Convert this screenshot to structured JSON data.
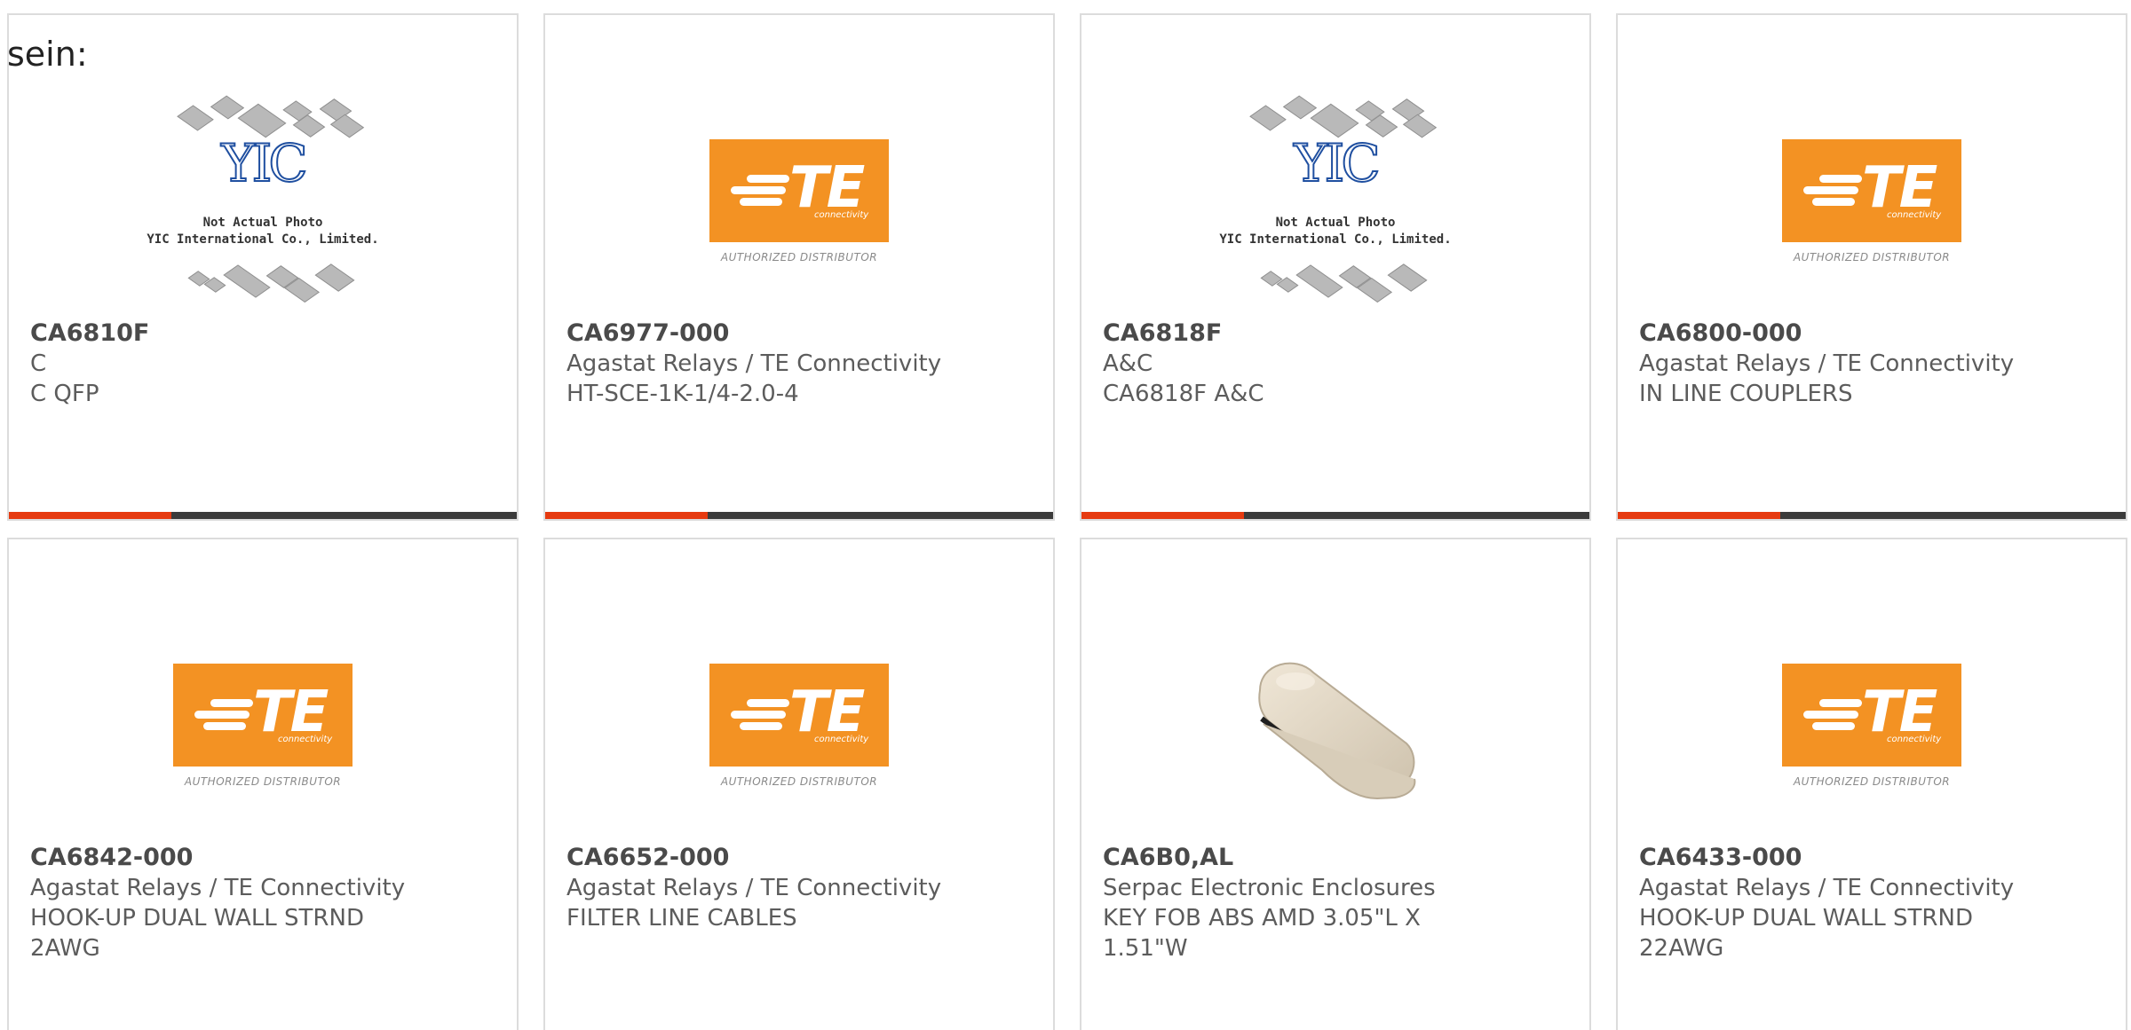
{
  "intro_text": "sein:",
  "products": [
    {
      "part": "CA6810F",
      "maker": "C",
      "desc": "C QFP",
      "image": "yic-placeholder",
      "image_caption": [
        "Not Actual Photo",
        "YIC International Co., Limited."
      ]
    },
    {
      "part": "CA6977-000",
      "maker": "Agastat Relays / TE Connectivity",
      "desc": "HT-SCE-1K-1/4-2.0-4",
      "image": "te-logo"
    },
    {
      "part": "CA6818F",
      "maker": "A&C",
      "desc": "CA6818F A&C",
      "image": "yic-placeholder",
      "image_caption": [
        "Not Actual Photo",
        "YIC International Co., Limited."
      ]
    },
    {
      "part": "CA6800-000",
      "maker": "Agastat Relays / TE Connectivity",
      "desc": "IN LINE COUPLERS",
      "image": "te-logo"
    },
    {
      "part": "CA6842-000",
      "maker": "Agastat Relays / TE Connectivity",
      "desc": "HOOK-UP DUAL WALL STRND 2AWG",
      "image": "te-logo"
    },
    {
      "part": "CA6652-000",
      "maker": "Agastat Relays / TE Connectivity",
      "desc": "FILTER LINE CABLES",
      "image": "te-logo"
    },
    {
      "part": "CA6B0,AL",
      "maker": "Serpac Electronic Enclosures",
      "desc": "KEY FOB ABS AMD 3.05\"L X 1.51\"W",
      "image": "key-fob-photo"
    },
    {
      "part": "CA6433-000",
      "maker": "Agastat Relays / TE Connectivity",
      "desc": "HOOK-UP DUAL WALL STRND 22AWG",
      "image": "te-logo"
    }
  ],
  "te_logo": {
    "letters": "TE",
    "subtitle": "connectivity",
    "authorized": "AUTHORIZED DISTRIBUTOR"
  },
  "yic_logo": {
    "letters": "YIC"
  },
  "card_progress_fraction": 0.32,
  "colors": {
    "accent": "#e63a10",
    "bar_track": "#3b3b3b",
    "te_orange": "#f39223",
    "text": "#5c5c5c",
    "card_border": "#dcdcdc"
  }
}
